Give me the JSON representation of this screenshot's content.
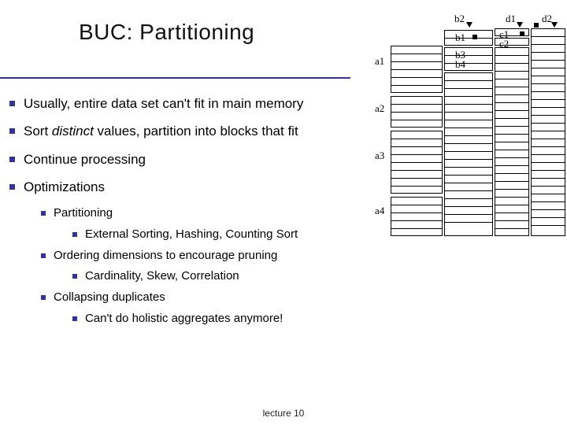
{
  "title": "BUC: Partitioning",
  "bullets": {
    "b1": "Usually, entire data set can't fit in main memory",
    "b2_pre": "Sort ",
    "b2_em": "distinct",
    "b2_post": " values, partition into blocks that fit",
    "b3": "Continue processing",
    "b4": "Optimizations",
    "b4_1": "Partitioning",
    "b4_1_1": "External Sorting, Hashing, Counting Sort",
    "b4_2": "Ordering dimensions to encourage pruning",
    "b4_2_1": "Cardinality, Skew, Correlation",
    "b4_3": "Collapsing duplicates",
    "b4_3_1": "Can't do holistic aggregates anymore!"
  },
  "diagram": {
    "a1": "a1",
    "a2": "a2",
    "a3": "a3",
    "a4": "a4",
    "b1": "b1",
    "b2": "b2",
    "b3": "b3",
    "b4": "b4",
    "c1": "c1",
    "c2": "c2",
    "d1": "d1",
    "d2": "d2"
  },
  "footer": "lecture 10"
}
